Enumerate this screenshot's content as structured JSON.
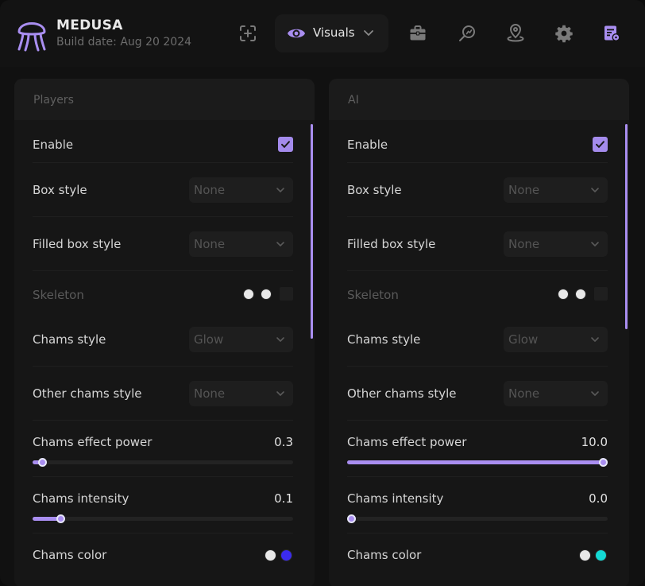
{
  "app": {
    "title": "MEDUSA",
    "build": "Build date: Aug 20 2024",
    "accent": "#a98ef0"
  },
  "nav": {
    "active_tab": "Visuals",
    "icons": [
      "add-target-icon",
      "eye-icon",
      "briefcase-icon",
      "radar-search-icon",
      "map-pin-icon",
      "gear-icon",
      "config-list-icon"
    ]
  },
  "panels": [
    {
      "title": "Players",
      "enable_label": "Enable",
      "enable_checked": true,
      "box_style": {
        "label": "Box style",
        "value": "None"
      },
      "filled_box_style": {
        "label": "Filled box style",
        "value": "None"
      },
      "skeleton": {
        "label": "Skeleton",
        "colors": [
          "#e8e8e8",
          "#e8e8e8"
        ]
      },
      "chams_style": {
        "label": "Chams style",
        "value": "Glow"
      },
      "other_chams_style": {
        "label": "Other chams style",
        "value": "None"
      },
      "chams_effect_power": {
        "label": "Chams effect power",
        "value": "0.3",
        "level": 0.03
      },
      "chams_intensity": {
        "label": "Chams intensity",
        "value": "0.1",
        "level": 0.1
      },
      "chams_color": {
        "label": "Chams color",
        "colors": [
          "#e8e8e8",
          "#3b2bf0"
        ]
      }
    },
    {
      "title": "AI",
      "enable_label": "Enable",
      "enable_checked": true,
      "box_style": {
        "label": "Box style",
        "value": "None"
      },
      "filled_box_style": {
        "label": "Filled box style",
        "value": "None"
      },
      "skeleton": {
        "label": "Skeleton",
        "colors": [
          "#e8e8e8",
          "#e8e8e8"
        ]
      },
      "chams_style": {
        "label": "Chams style",
        "value": "Glow"
      },
      "other_chams_style": {
        "label": "Other chams style",
        "value": "None"
      },
      "chams_effect_power": {
        "label": "Chams effect power",
        "value": "10.0",
        "level": 1.0
      },
      "chams_intensity": {
        "label": "Chams intensity",
        "value": "0.0",
        "level": 0.0
      },
      "chams_color": {
        "label": "Chams color",
        "colors": [
          "#e8e8e8",
          "#14d9d4"
        ]
      }
    }
  ]
}
